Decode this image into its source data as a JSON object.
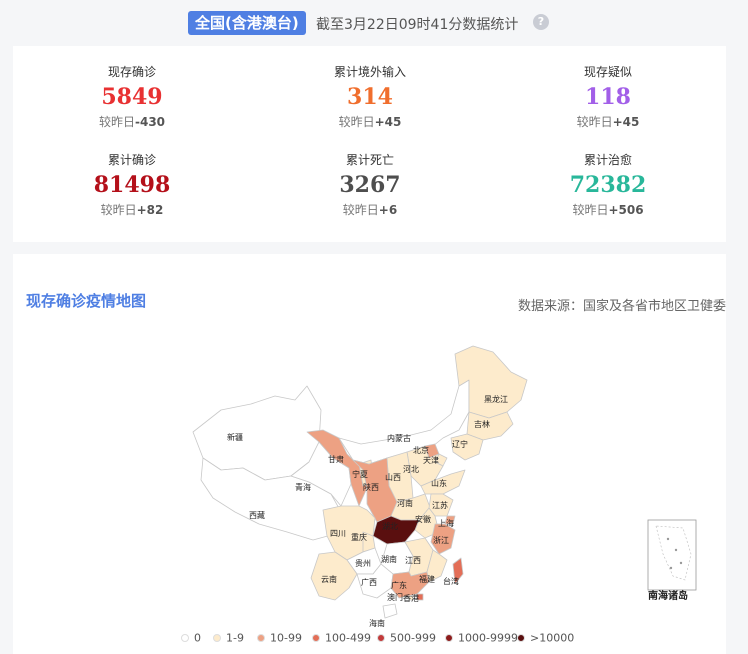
{
  "header": {
    "region": "全国(含港澳台)",
    "caption": "截至3月22日09时41分数据统计",
    "help_glyph": "?"
  },
  "stats": [
    {
      "label": "现存确诊",
      "value": "5849",
      "delta_prefix": "较昨日",
      "delta": "-430",
      "color": "#e83132"
    },
    {
      "label": "累计境外输入",
      "value": "314",
      "delta_prefix": "较昨日",
      "delta": "+45",
      "color": "#f06e2d"
    },
    {
      "label": "现存疑似",
      "value": "118",
      "delta_prefix": "较昨日",
      "delta": "+45",
      "color": "#a25fe8"
    },
    {
      "label": "累计确诊",
      "value": "81498",
      "delta_prefix": "较昨日",
      "delta": "+82",
      "color": "#b4101a"
    },
    {
      "label": "累计死亡",
      "value": "3267",
      "delta_prefix": "较昨日",
      "delta": "+6",
      "color": "#4e4e4e"
    },
    {
      "label": "累计治愈",
      "value": "72382",
      "delta_prefix": "较昨日",
      "delta": "+506",
      "color": "#28b79a"
    }
  ],
  "map": {
    "title": "现存确诊疫情地图",
    "source": "数据来源：国家及各省市地区卫健委",
    "inset_label": "南海诸岛",
    "provinces": [
      {
        "name": "新疆",
        "tier": 0
      },
      {
        "name": "西藏",
        "tier": 0
      },
      {
        "name": "青海",
        "tier": 0
      },
      {
        "name": "甘肃",
        "tier": 2
      },
      {
        "name": "内蒙古",
        "tier": 0
      },
      {
        "name": "黑龙江",
        "tier": 1
      },
      {
        "name": "吉林",
        "tier": 1
      },
      {
        "name": "辽宁",
        "tier": 1
      },
      {
        "name": "北京",
        "tier": 2
      },
      {
        "name": "天津",
        "tier": 1
      },
      {
        "name": "河北",
        "tier": 1
      },
      {
        "name": "山西",
        "tier": 1
      },
      {
        "name": "宁夏",
        "tier": 1
      },
      {
        "name": "陕西",
        "tier": 2
      },
      {
        "name": "山东",
        "tier": 1
      },
      {
        "name": "河南",
        "tier": 1
      },
      {
        "name": "江苏",
        "tier": 1
      },
      {
        "name": "安徽",
        "tier": 1
      },
      {
        "name": "上海",
        "tier": 2
      },
      {
        "name": "湖北",
        "tier": 6
      },
      {
        "name": "浙江",
        "tier": 2
      },
      {
        "name": "四川",
        "tier": 1
      },
      {
        "name": "重庆",
        "tier": 1
      },
      {
        "name": "湖南",
        "tier": 0
      },
      {
        "name": "江西",
        "tier": 1
      },
      {
        "name": "福建",
        "tier": 1
      },
      {
        "name": "台湾",
        "tier": 3
      },
      {
        "name": "贵州",
        "tier": 0
      },
      {
        "name": "云南",
        "tier": 1
      },
      {
        "name": "广西",
        "tier": 0
      },
      {
        "name": "广东",
        "tier": 2
      },
      {
        "name": "香港",
        "tier": 3
      },
      {
        "name": "澳门",
        "tier": 1
      },
      {
        "name": "海南",
        "tier": 0
      }
    ],
    "legend": [
      {
        "label": "0",
        "color": "#ffffff"
      },
      {
        "label": "1-9",
        "color": "#fdebcc"
      },
      {
        "label": "10-99",
        "color": "#eda183"
      },
      {
        "label": "100-499",
        "color": "#e36e57"
      },
      {
        "label": "500-999",
        "color": "#c23a3a"
      },
      {
        "label": "1000-9999",
        "color": "#8d1c1c"
      },
      {
        "label": ">10000",
        "color": "#5a0f0f"
      }
    ]
  }
}
